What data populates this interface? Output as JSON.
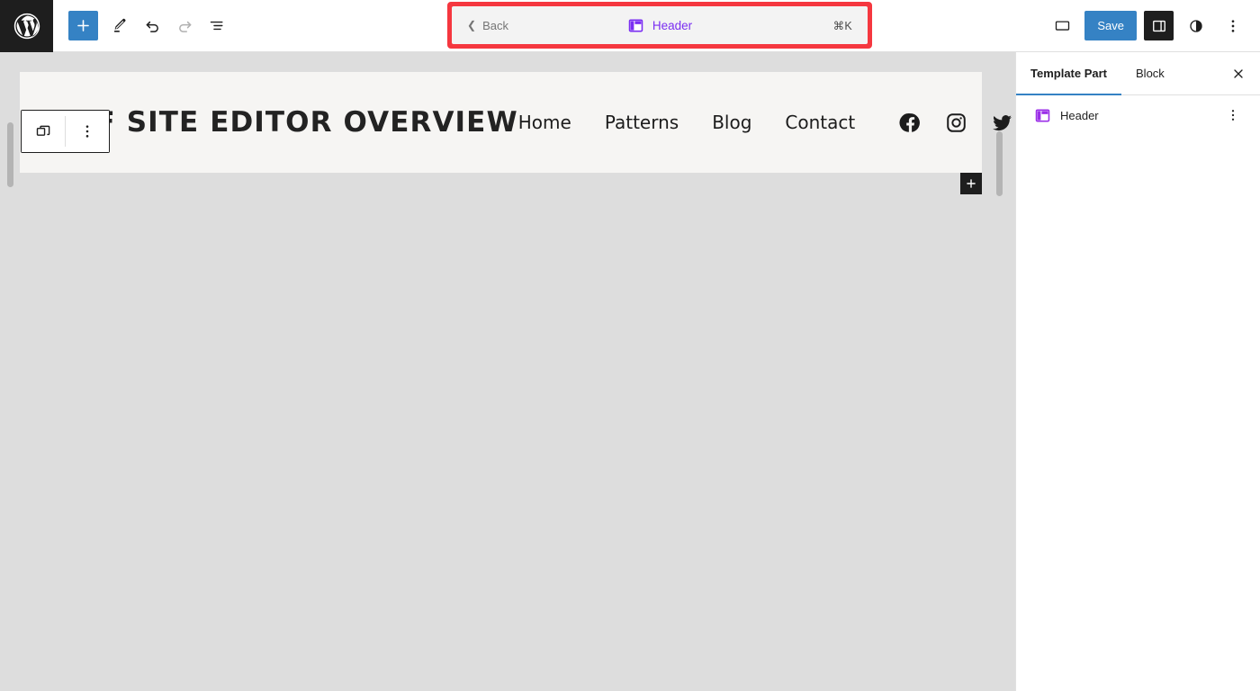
{
  "topbar": {
    "logo_icon": "wordpress-logo-icon",
    "tools": [
      {
        "name": "block-inserter-button",
        "icon": "plus-icon",
        "label": "Toggle block inserter",
        "state": "primary"
      },
      {
        "name": "tools-button",
        "icon": "pencil-icon",
        "label": "Tools",
        "state": "default"
      },
      {
        "name": "undo-button",
        "icon": "undo-icon",
        "label": "Undo",
        "state": "default"
      },
      {
        "name": "redo-button",
        "icon": "redo-icon",
        "label": "Redo",
        "state": "disabled"
      },
      {
        "name": "list-view-button",
        "icon": "list-view-icon",
        "label": "List View",
        "state": "default"
      }
    ],
    "command_bar": {
      "back_label": "Back",
      "back_icon": "chevron-left-icon",
      "title": "Header",
      "title_icon": "template-part-icon",
      "shortcut": "⌘K",
      "highlight_color": "#f5373f",
      "title_color": "#7b2ff2"
    },
    "right_tools": {
      "device_preview_label": "View",
      "device_preview_icon": "desktop-icon",
      "save_label": "Save",
      "save_color": "#3582c4",
      "settings_toggle_icon": "sidebar-panel-icon",
      "settings_toggle_state": "active",
      "styles_icon": "contrast-circle-icon",
      "options_icon": "kebab-menu-icon"
    }
  },
  "canvas": {
    "block_toolbar": {
      "select_parent_icon": "template-part-icon",
      "options_icon": "kebab-menu-icon"
    },
    "appender_icon": "plus-icon",
    "site": {
      "title": "GF SITE EDITOR OVERVIEW",
      "nav": [
        {
          "label": "Home"
        },
        {
          "label": "Patterns"
        },
        {
          "label": "Blog"
        },
        {
          "label": "Contact"
        }
      ],
      "social": [
        {
          "name": "facebook-icon"
        },
        {
          "name": "instagram-icon"
        },
        {
          "name": "twitter-icon"
        }
      ]
    }
  },
  "sidebar": {
    "tabs": [
      {
        "label": "Template Part",
        "name": "tab-template-part",
        "active": true
      },
      {
        "label": "Block",
        "name": "tab-block",
        "active": false
      }
    ],
    "close_icon": "close-icon",
    "rows": [
      {
        "label": "Header",
        "icon": "template-part-icon",
        "menu_icon": "kebab-menu-icon"
      }
    ],
    "accent_color": "#3582c4"
  }
}
